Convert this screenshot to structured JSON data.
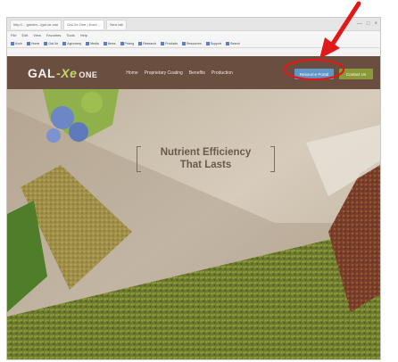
{
  "browser": {
    "tabs": [
      {
        "label": "http://... garden.../gal-xe-one",
        "active": false
      },
      {
        "label": "Gal-Xe One | Koch ...",
        "active": true
      },
      {
        "label": "New tab",
        "active": false
      }
    ],
    "window_controls": [
      "—",
      "□",
      "×"
    ],
    "menu": [
      "File",
      "Edit",
      "View",
      "Favorites",
      "Tools",
      "Help"
    ],
    "favorites": [
      "Koch",
      "Home",
      "Gal-Xe",
      "Agronomy",
      "Media",
      "News",
      "Pricing",
      "Research",
      "Products",
      "Resources",
      "Support",
      "Search"
    ]
  },
  "site": {
    "logo": {
      "part1": "GAL",
      "part2": "-Xe",
      "part3": "ONE"
    },
    "nav": [
      "Home",
      "Proprietary Coating",
      "Benefits",
      "Production"
    ],
    "login_button": "Resource Portal",
    "contact_button": "Contact Us",
    "colors": {
      "header": "#6a4e3f",
      "login": "#5e97c8",
      "contact": "#8a9a38"
    }
  },
  "hero": {
    "headline_line1": "Nutrient Efficiency",
    "headline_line2": "That Lasts"
  },
  "annotation": {
    "color": "#e01818"
  }
}
